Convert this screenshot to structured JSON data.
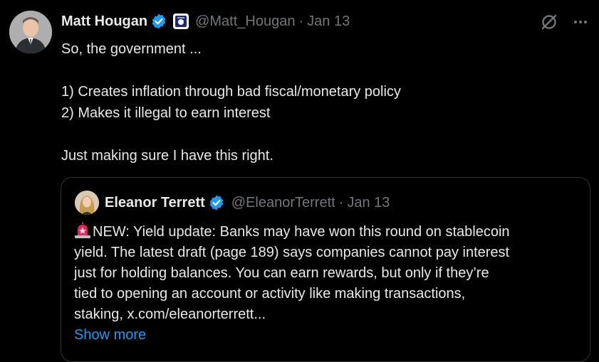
{
  "tweet": {
    "author_name": "Matt Hougan",
    "author_handle": "@Matt_Hougan",
    "separator": "·",
    "date": "Jan 13",
    "lines": [
      "So, the government ...",
      "",
      "1) Creates inflation through bad fiscal/monetary policy",
      "2) Makes it illegal to earn interest",
      "",
      "Just making sure I have this right."
    ]
  },
  "quote": {
    "author_name": "Eleanor Terrett",
    "author_handle": "@EleanorTerrett",
    "separator": "·",
    "date": "Jan 13",
    "lines": [
      "NEW: Yield update: Banks may have won this round on stablecoin",
      "yield. The latest draft (page 189) says companies cannot pay interest",
      "just for holding balances. You can earn rewards, but only if they’re",
      "tied to opening an account or activity like making transactions,",
      "staking, x.com/eleanorterrett..."
    ],
    "show_more": "Show more"
  },
  "icons": {
    "verified": "verified-badge-icon",
    "affiliate": "affiliate-badge-icon",
    "grok": "grok-icon",
    "more": "more-options-icon",
    "siren": "police-light-emoji"
  },
  "colors": {
    "background": "#000000",
    "text": "#e7e9ea",
    "muted": "#71767b",
    "accent": "#1d9bf0",
    "border": "#2f3336"
  }
}
